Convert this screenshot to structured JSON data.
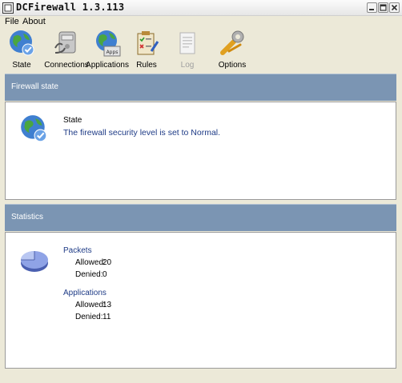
{
  "window": {
    "title": "DCFirewall 1.3.113"
  },
  "menu": {
    "items": [
      {
        "label": "File"
      },
      {
        "label": "About"
      }
    ]
  },
  "toolbar": {
    "items": [
      {
        "label": "State",
        "icon": "globe-check-icon"
      },
      {
        "label": "Connections",
        "icon": "connections-icon"
      },
      {
        "label": "Applications",
        "icon": "applications-icon",
        "sub": "Apps"
      },
      {
        "label": "Rules",
        "icon": "rules-icon"
      },
      {
        "label": "Log",
        "icon": "log-icon",
        "disabled": true
      },
      {
        "label": "Options",
        "icon": "options-icon"
      }
    ]
  },
  "firewall_state": {
    "header": "Firewall state",
    "state_label": "State",
    "message": "The firewall security level is set to Normal."
  },
  "statistics": {
    "header": "Statistics",
    "packets": {
      "label": "Packets",
      "allowed_label": "Allowed:",
      "allowed": "20",
      "denied_label": "Denied:",
      "denied": "0"
    },
    "applications": {
      "label": "Applications",
      "allowed_label": "Allowed:",
      "allowed": "13",
      "denied_label": "Denied:",
      "denied": "11"
    }
  },
  "colors": {
    "band": "#7b95b3",
    "link_blue": "#1e3b86",
    "window_bg": "#ece9d8"
  }
}
